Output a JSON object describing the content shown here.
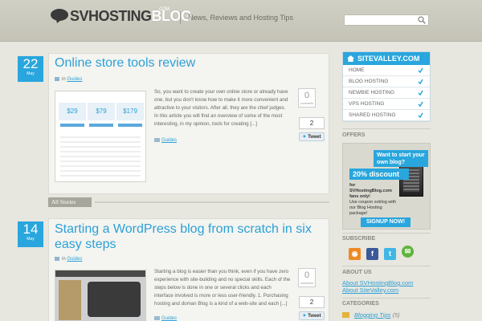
{
  "header": {
    "logo_main": "SVHOSTING",
    "logo_accent": "BLOG",
    "logo_suffix": ".COM",
    "tagline": "News, Reviews and Hosting Tips",
    "search_placeholder": ""
  },
  "posts": [
    {
      "day": "22",
      "month": "May",
      "title": "Online store tools review",
      "category_prefix": "in",
      "category": "Guides",
      "excerpt": "So, you want to create your own online store or already have one, but you don't know how to make it more convenient and attractive to your visitors. After all, they are the chief judges. In this article you will find an overview of some of the most interesting, in my opinion, tools for creating [...]",
      "tag": "Guides",
      "comments": "0",
      "comments_label": "comments",
      "share_count": "2",
      "tweet_label": "Tweet",
      "thumb_prices": [
        "$29",
        "$79",
        "$179"
      ]
    },
    {
      "day": "14",
      "month": "May",
      "title": "Starting a WordPress blog from scratch in six easy steps",
      "category_prefix": "in",
      "category": "Guides",
      "excerpt": "Starting a blog is easier than you think, even if you have zero experience with site-building and no special skills. Each of the steps below is done in one or several clicks and each interface involved is more or less user-friendly. 1. Purchasing hosting and doman Blog is a kind of a web-site and each [...]",
      "tag": "Guides",
      "comments": "0",
      "comments_label": "comments",
      "share_count": "2",
      "tweet_label": "Tweet"
    }
  ],
  "all_stories": "All Stories",
  "sidebar": {
    "sitevalley_title": "SITEVALLEY.COM",
    "sitevalley_items": [
      "HOME",
      "BLOG HOSTING",
      "NEWBIE HOSTING",
      "VPS HOSTING",
      "SHARED HOSTING"
    ],
    "offers_title": "OFFERS",
    "offer_want": "Want to start your own blog?",
    "offer_discount": "20% discount",
    "offer_fans_1": "for SVHostingBlog.com fans only!",
    "offer_fans_2": "Use coupon svblog with our Blog Hosting package!",
    "offer_signup": "SIGNUP NOW!",
    "subscribe_title": "SUBSCRIBE",
    "about_title": "ABOUT US",
    "about_links": [
      "About SVHostingBlog.com",
      "About SiteValley.com"
    ],
    "categories_title": "CATEGORIES",
    "category_name": "Blogging Tips",
    "category_count": "(5)"
  },
  "colors": {
    "accent": "#29a6dd",
    "header_bg": "#c9c8bc",
    "page_bg": "#e7e6df"
  }
}
